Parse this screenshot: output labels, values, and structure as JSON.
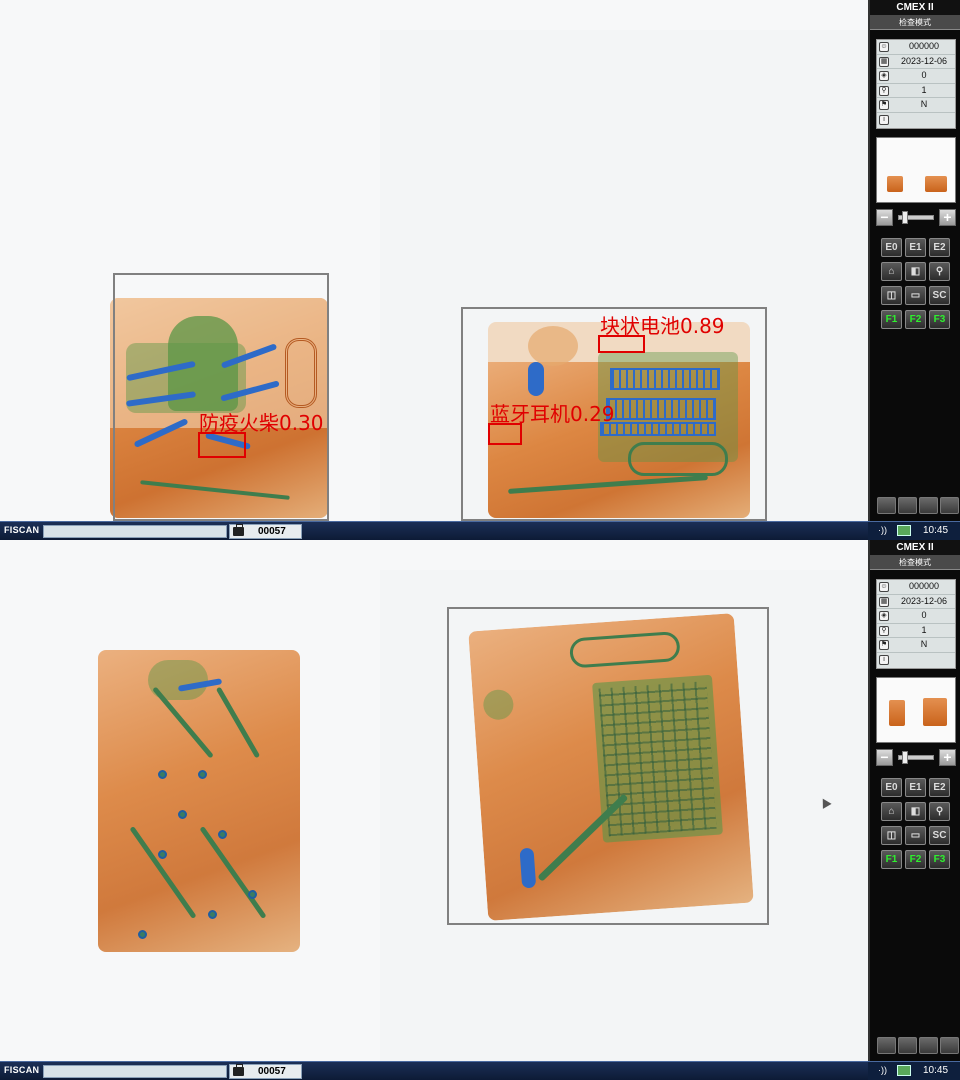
{
  "screens": [
    {
      "id": "top",
      "detections": [
        {
          "label": "防疫火柴0.30"
        },
        {
          "label": "块状电池0.89"
        },
        {
          "label": "蓝牙耳机0.29"
        }
      ],
      "panel": {
        "title": "CMEX II",
        "mode": "检查模式",
        "info": {
          "operator": "000000",
          "date": "2023-12-06",
          "scan_count": "0",
          "zoom": "1",
          "flag": "N",
          "note": ""
        }
      },
      "taskbar": {
        "brand": "FISCAN",
        "field": "",
        "count": "00057",
        "time": "10:45"
      }
    },
    {
      "id": "bottom",
      "detections": [],
      "panel": {
        "title": "CMEX II",
        "mode": "检查模式",
        "info": {
          "operator": "000000",
          "date": "2023-12-06",
          "scan_count": "0",
          "zoom": "1",
          "flag": "N",
          "note": ""
        }
      },
      "taskbar": {
        "brand": "FISCAN",
        "field": "",
        "count": "00057",
        "time": "10:45"
      }
    }
  ],
  "keys": [
    "E0",
    "E1",
    "E2",
    "",
    "",
    "",
    "",
    "",
    "SC",
    "F1",
    "F2",
    "F3"
  ],
  "key_icons": [
    "",
    "",
    "",
    "home-icon",
    "contrast-icon",
    "magnifier-icon",
    "split-icon",
    "edge-icon",
    "",
    "",
    "",
    ""
  ],
  "colors": {
    "detection": "#e00000",
    "frame": "#808080",
    "function_key_text": "#2ef02e"
  }
}
